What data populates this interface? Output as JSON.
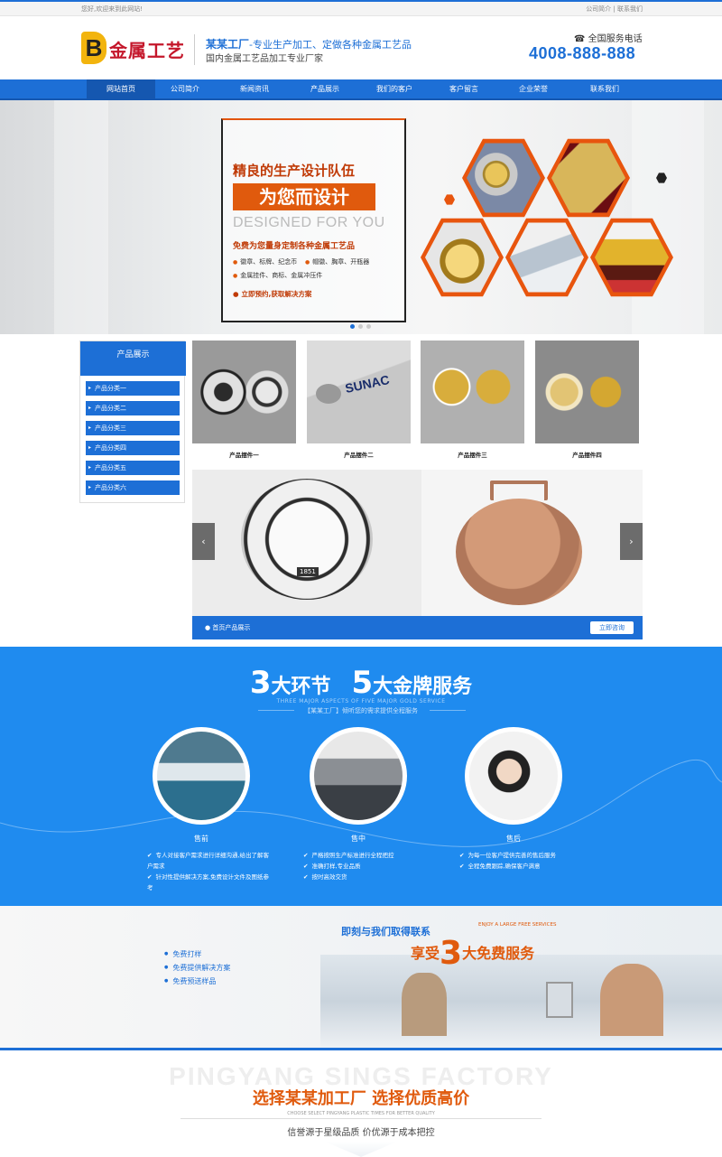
{
  "topbar": {
    "welcome": "您好,欢迎来到此网站!",
    "links": "公司简介 | 联系我们"
  },
  "header": {
    "logo_mark": "B",
    "logo_text": "金属工艺",
    "slogan_brand": "某某工厂",
    "slogan_rest": "-专业生产加工、定做各种金属工艺品",
    "slogan2": "国内金属工艺品加工专业厂家",
    "phone_label": "全国服务电话",
    "phone": "4008-888-888"
  },
  "nav": [
    "网站首页",
    "公司简介",
    "新闻资讯",
    "产品展示",
    "我们的客户",
    "客户留言",
    "企业荣誉",
    "联系我们"
  ],
  "banner": {
    "heading": "精良的生产设计队伍",
    "highlight": "为您而设计",
    "english": "DESIGNED FOR YOU",
    "subhead": "免费为您量身定制各种金属工艺品",
    "features": [
      "徽章、标牌、纪念币",
      "帽徽、胸章、开瓶器",
      "金属挂件、商标、金属冲压件"
    ],
    "cta": "立即预约,获取解决方案"
  },
  "sidebar": {
    "title": "产品展示",
    "items": [
      "产品分类一",
      "产品分类二",
      "产品分类三",
      "产品分类四",
      "产品分类五",
      "产品分类六"
    ]
  },
  "products": [
    "产品摆件一",
    "产品摆件二",
    "产品摆件三",
    "产品摆件四"
  ],
  "slider": {
    "caption": "首页产品展示",
    "button": "立即咨询",
    "prev": "‹",
    "next": "›",
    "medal_year": "1851"
  },
  "services": {
    "n1": "3",
    "t1": "大环节",
    "n2": "5",
    "t2": "大金牌服务",
    "english": "THREE MAJOR ASPECTS OF FIVE MAJOR GOLD SERVICE",
    "sub": "【某某工厂】倾听您的需求提供全程服务",
    "stages": [
      {
        "name": "售前",
        "points": [
          "专人对接客户需求进行详细沟通,给出了解客户需求",
          "针对性提供解决方案,免费设计文件及图纸参考"
        ]
      },
      {
        "name": "售中",
        "points": [
          "严格按照生产标准进行全程把控",
          "准确打样,专业品质",
          "按时高效交货"
        ]
      },
      {
        "name": "售后",
        "points": [
          "为每一位客户提供完善的售后服务",
          "全程免费跟踪,确保客户满意"
        ]
      }
    ]
  },
  "free": {
    "items": [
      "免费打样",
      "免费提供解决方案",
      "免费预送样品"
    ],
    "title1": "即刻与我们取得联系",
    "english": "ENJOY A LARGE FREE SERVICES",
    "t_pre": "享受",
    "number": "3",
    "t_post": "大免费服务"
  },
  "choose": {
    "english": "PINGYANG SINGS FACTORY",
    "title": "选择某某加工厂 选择优质高价",
    "english2": "CHOOSE SELECT PINGYANG PLASTIC TIMES FOR BETTER QUALITY",
    "sub": "信誉源于星级品质 价优源于成本把控"
  },
  "colors": {
    "primary": "#1d6fd6",
    "accent": "#e05a0d",
    "service_bg": "#1f8bef"
  }
}
